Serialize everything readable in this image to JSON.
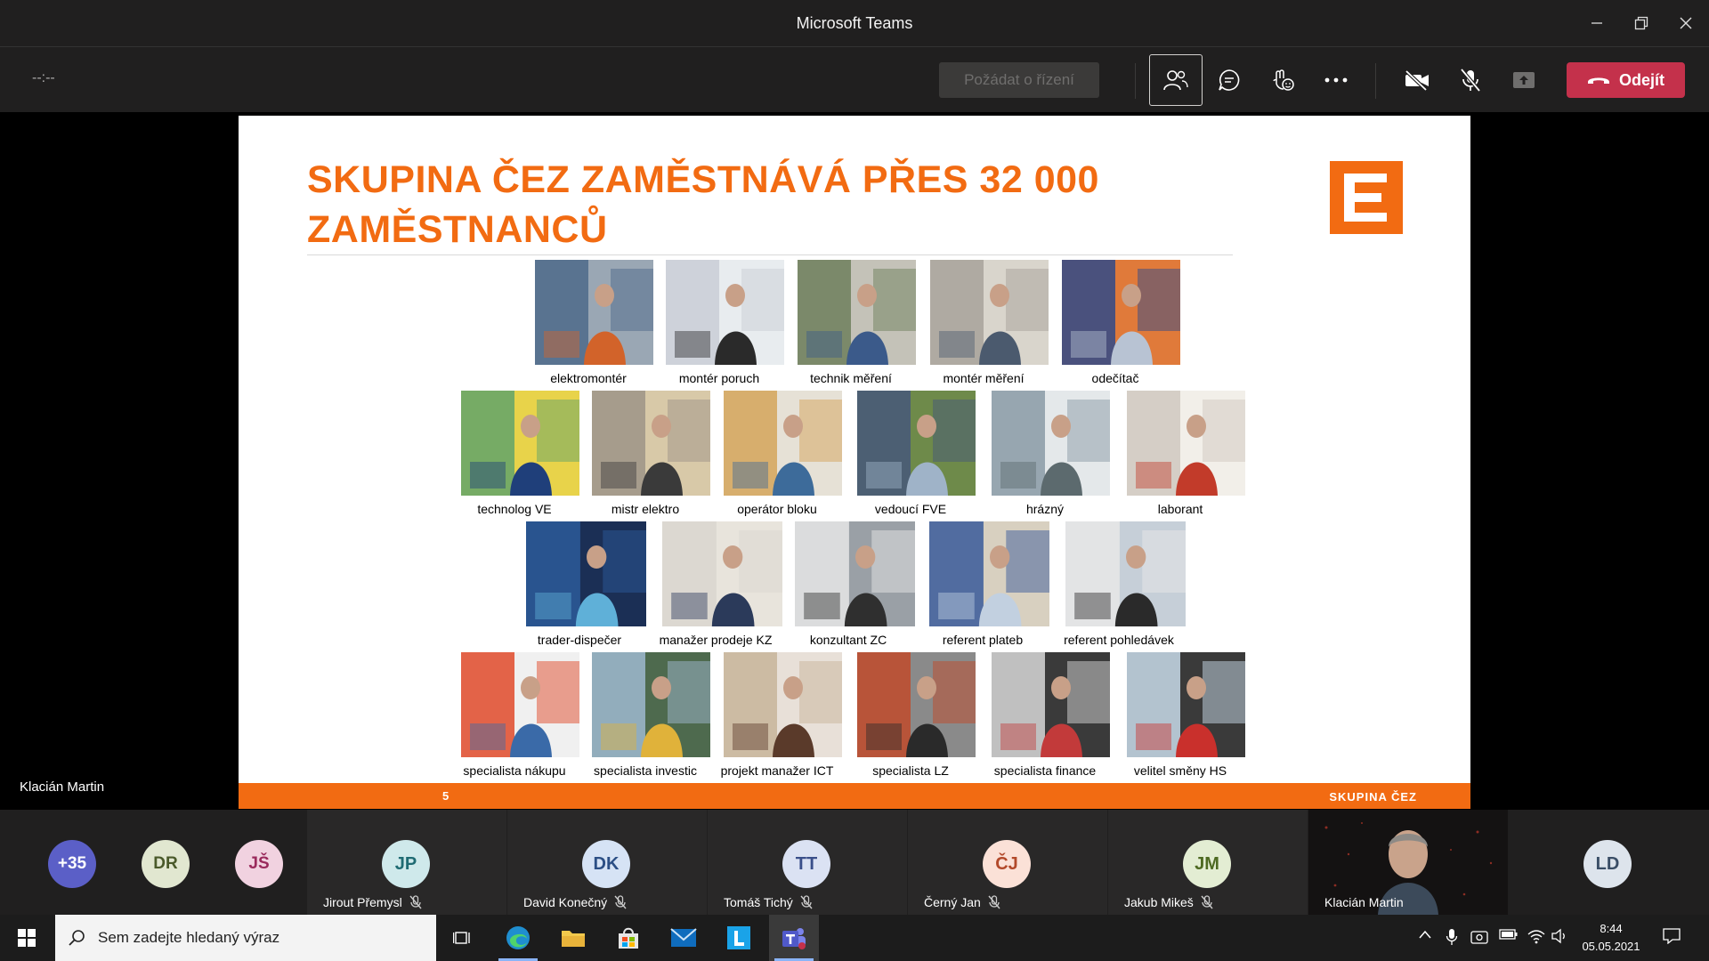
{
  "window": {
    "title": "Microsoft Teams"
  },
  "toolbar": {
    "timer": "--:--",
    "request_control": "Požádat o řízení",
    "leave": "Odejít"
  },
  "stage": {
    "presenter_label": "Klacián Martin"
  },
  "slide": {
    "headline_line1": "SKUPINA ČEZ ZAMĚSTNÁVÁ PŘES 32 000",
    "headline_line2": "ZAMĚSTNANCŮ",
    "page_number": "5",
    "footer_brand": "SKUPINA ČEZ",
    "brand_color": "#f26b12",
    "photos": [
      "elektromontér",
      "montér poruch",
      "technik měření",
      "montér měření",
      "odečítač",
      "technolog VE",
      "mistr elektro",
      "operátor bloku",
      "vedoucí FVE",
      "hrázný",
      "laborant",
      "trader-dispečer",
      "manažer prodeje KZ",
      "konzultant ZC",
      "referent plateb",
      "referent pohledávek",
      "specialista nákupu",
      "specialista investic",
      "projekt manažer ICT",
      "specialista LZ",
      "specialista finance",
      "velitel směny HS"
    ]
  },
  "participants": {
    "overflow": "+35",
    "badges": [
      "DR",
      "JŠ"
    ],
    "tiles": [
      {
        "initials": "JP",
        "name": "Jirout Přemysl"
      },
      {
        "initials": "DK",
        "name": "David Konečný"
      },
      {
        "initials": "TT",
        "name": "Tomáš Tichý"
      },
      {
        "initials": "ČJ",
        "name": "Černý Jan"
      },
      {
        "initials": "JM",
        "name": "Jakub Mikeš"
      }
    ],
    "video_tile_name": "Klacián Martin",
    "last_badge": "LD"
  },
  "taskbar": {
    "search_placeholder": "Sem zadejte hledaný výraz",
    "time": "8:44",
    "date": "05.05.2021"
  }
}
